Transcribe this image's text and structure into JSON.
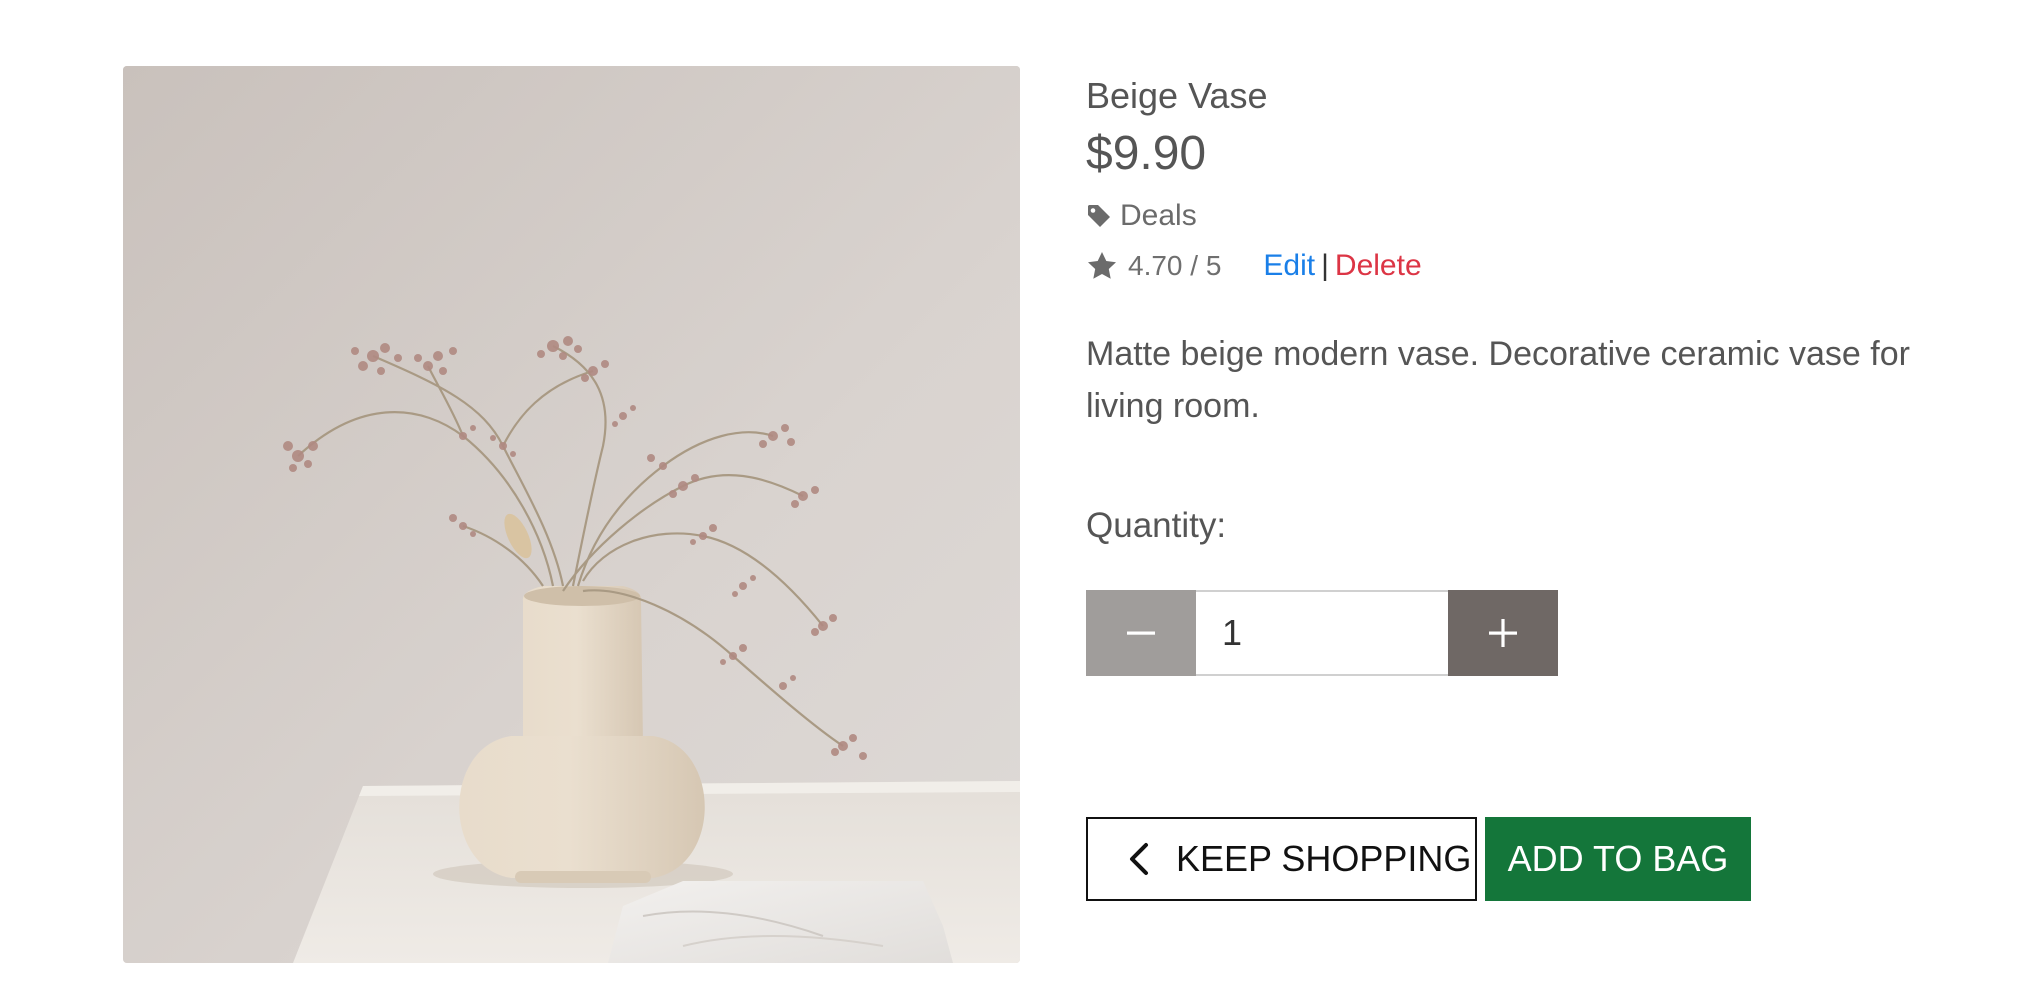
{
  "product": {
    "name": "Beige Vase",
    "price": "$9.90",
    "category": "Deals",
    "rating": "4.70 / 5",
    "description": "Matte beige modern vase. Decorative ceramic vase for living room.",
    "image_alt": "Beige vase with dried flowers"
  },
  "admin": {
    "edit_label": "Edit",
    "separator": "|",
    "delete_label": "Delete"
  },
  "quantity": {
    "label": "Quantity:",
    "value": "1"
  },
  "actions": {
    "keep_shopping_label": "KEEP SHOPPING",
    "add_to_bag_label": "ADD TO BAG"
  },
  "icons": {
    "category": "tag-icon",
    "rating": "star-icon",
    "decrement": "minus-icon",
    "increment": "plus-icon",
    "back": "chevron-left-icon"
  },
  "colors": {
    "edit_link": "#1a7fe8",
    "delete_link": "#dc3545",
    "add_to_bag_bg": "#14763a",
    "qty_minus_bg": "#a09d9b",
    "qty_plus_bg": "#6f6865"
  }
}
